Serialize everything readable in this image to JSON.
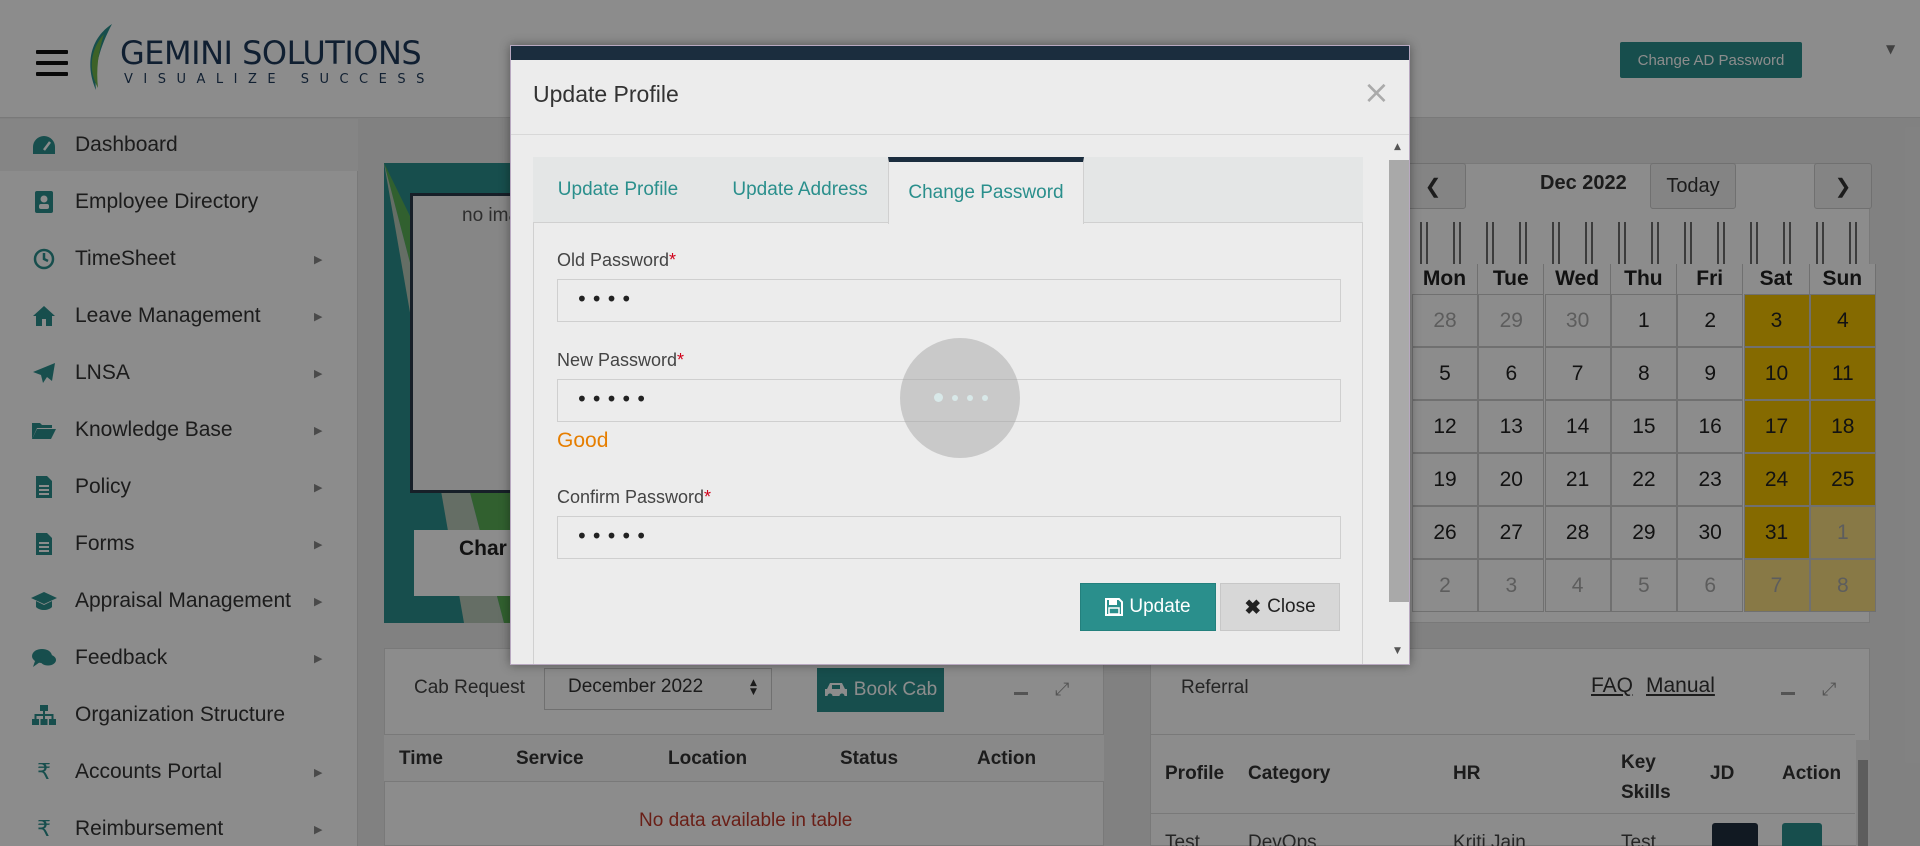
{
  "header": {
    "logo": {
      "brand": "GEMINI SOLUTIONS",
      "tagline": "VISUALIZE SUCCESS"
    },
    "change_ad_password_label": "Change AD Password"
  },
  "sidebar": {
    "items": [
      {
        "label": "Dashboard",
        "icon": "dashboard-icon",
        "has_submenu": false,
        "active": true
      },
      {
        "label": "Employee Directory",
        "icon": "contact-card-icon",
        "has_submenu": false
      },
      {
        "label": "TimeSheet",
        "icon": "clock-icon",
        "has_submenu": true
      },
      {
        "label": "Leave Management",
        "icon": "home-icon",
        "has_submenu": true
      },
      {
        "label": "LNSA",
        "icon": "paper-plane-icon",
        "has_submenu": true
      },
      {
        "label": "Knowledge Base",
        "icon": "folder-open-icon",
        "has_submenu": true
      },
      {
        "label": "Policy",
        "icon": "document-icon",
        "has_submenu": true
      },
      {
        "label": "Forms",
        "icon": "document-icon",
        "has_submenu": true
      },
      {
        "label": "Appraisal Management",
        "icon": "graduation-cap-icon",
        "has_submenu": true
      },
      {
        "label": "Feedback",
        "icon": "comments-icon",
        "has_submenu": true
      },
      {
        "label": "Organization Structure",
        "icon": "sitemap-icon",
        "has_submenu": false
      },
      {
        "label": "Accounts Portal",
        "icon": "rupee-icon",
        "has_submenu": true
      },
      {
        "label": "Reimbursement",
        "icon": "rupee-icon",
        "has_submenu": true
      }
    ]
  },
  "profile_card": {
    "image_alt": "no image",
    "name_partial": "Char"
  },
  "cab": {
    "title": "Cab Request",
    "month": "December 2022",
    "book_label": "Book Cab",
    "columns": [
      "Time",
      "Service",
      "Location",
      "Status",
      "Action"
    ],
    "empty_text": "No data available in table"
  },
  "calendar": {
    "month_label": "Dec 2022",
    "today_label": "Today",
    "prev_label": "❮",
    "next_label": "❯",
    "weekdays": [
      "Mon",
      "Tue",
      "Wed",
      "Thu",
      "Fri",
      "Sat",
      "Sun"
    ],
    "weeks": [
      [
        "28",
        "29",
        "30",
        "1",
        "2",
        "3",
        "4"
      ],
      [
        "5",
        "6",
        "7",
        "8",
        "9",
        "10",
        "11"
      ],
      [
        "12",
        "13",
        "14",
        "15",
        "16",
        "17",
        "18"
      ],
      [
        "19",
        "20",
        "21",
        "22",
        "23",
        "24",
        "25"
      ],
      [
        "26",
        "27",
        "28",
        "29",
        "30",
        "31",
        "1"
      ],
      [
        "2",
        "3",
        "4",
        "5",
        "6",
        "7",
        "8"
      ]
    ],
    "weekend_color": "#f2c200"
  },
  "referral": {
    "title": "Referral",
    "faq_label": "FAQ",
    "manual_label": "Manual",
    "columns": [
      "Profile",
      "Category",
      "HR",
      "Key Skills",
      "JD",
      "Action"
    ],
    "row": {
      "profile": "Test",
      "category": "DevOps",
      "hr": "Kriti Jain",
      "skills": "Test"
    }
  },
  "modal": {
    "title": "Update Profile",
    "close_symbol": "×",
    "tabs": [
      {
        "label": "Update Profile",
        "active": false
      },
      {
        "label": "Update Address",
        "active": false
      },
      {
        "label": "Change Password",
        "active": true
      }
    ],
    "fields": {
      "old_password": {
        "label": "Old Password",
        "value": "••••"
      },
      "new_password": {
        "label": "New Password",
        "value": "•••••"
      },
      "confirm_password": {
        "label": "Confirm Password",
        "value": "•••••"
      }
    },
    "required_mark": "*",
    "strength_text": "Good",
    "update_label": "Update",
    "close_label": "Close"
  },
  "colors": {
    "accent": "#2a8f8c",
    "modal_topbar": "#1b2d3e",
    "strength_good": "#e67e00",
    "required": "#d0021b"
  }
}
